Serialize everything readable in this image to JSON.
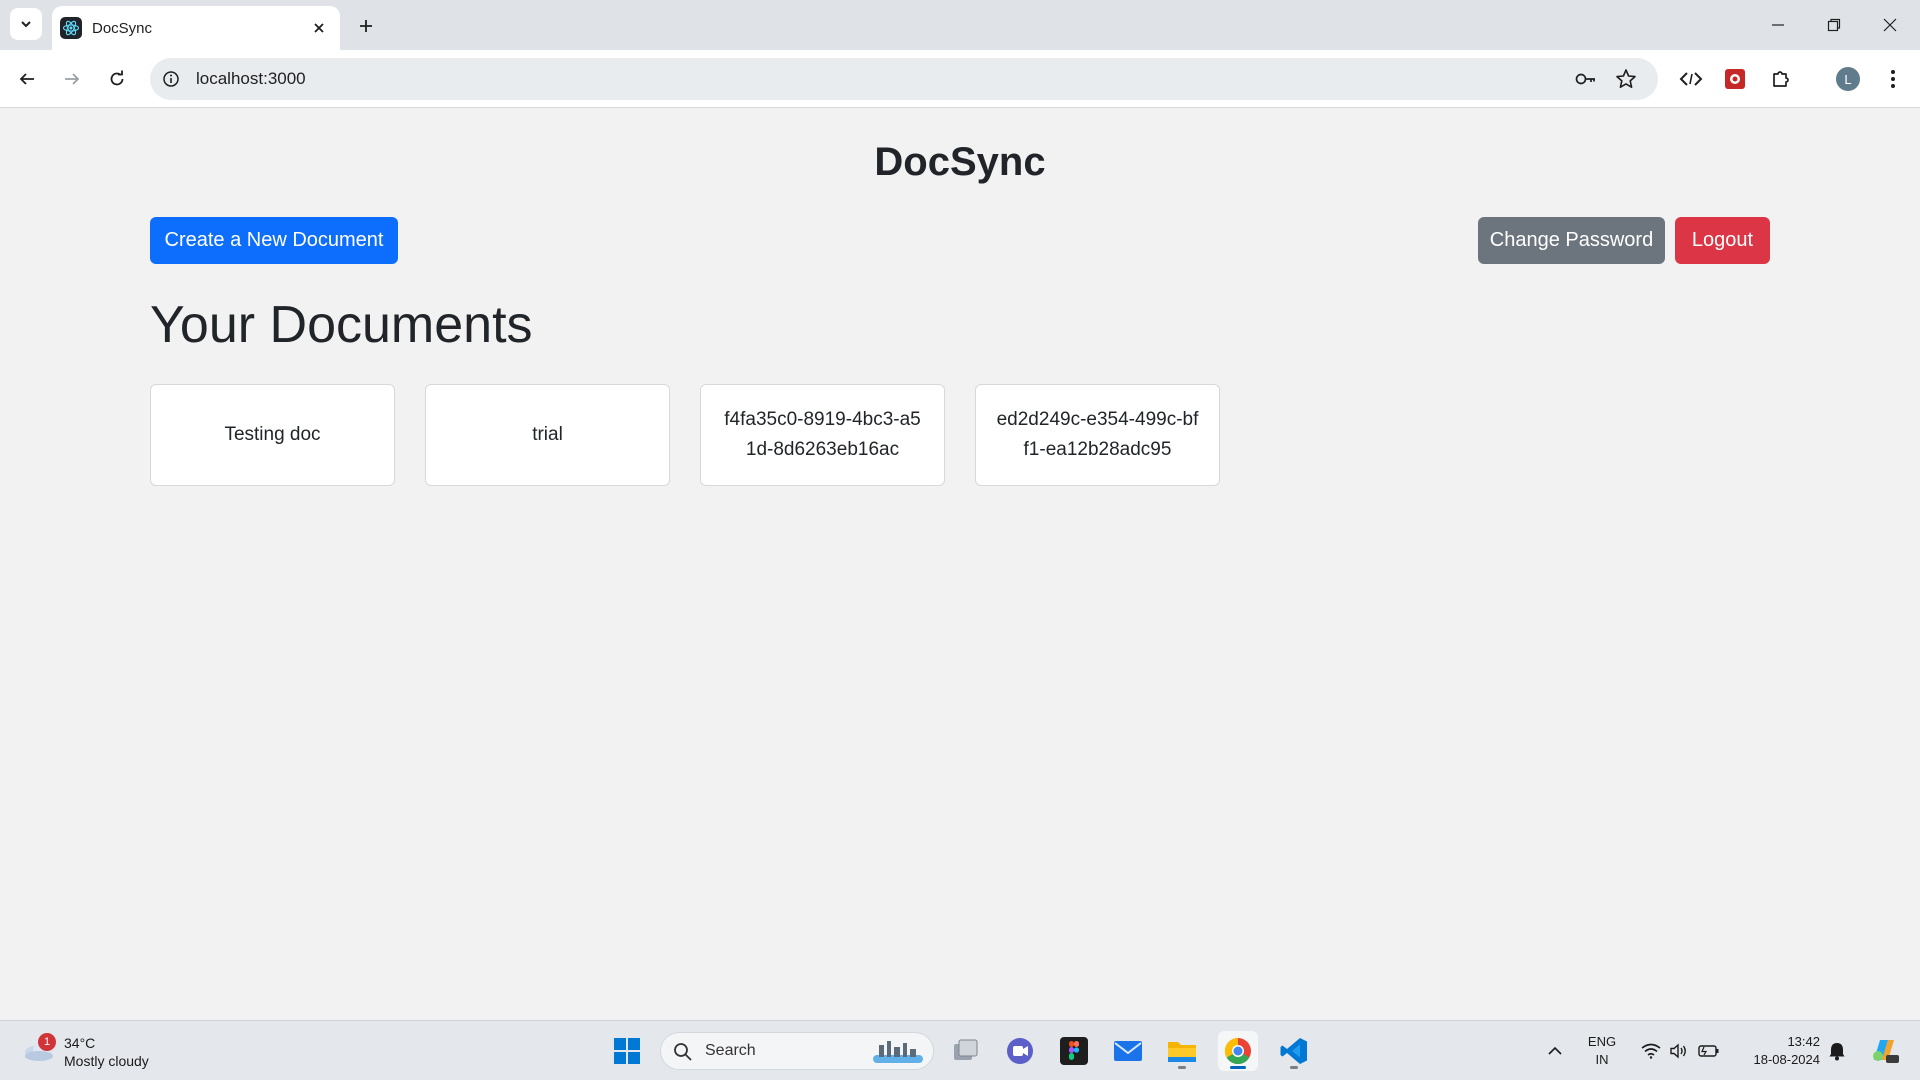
{
  "browser": {
    "tab_title": "DocSync",
    "url": "localhost:3000",
    "profile_initial": "L"
  },
  "app": {
    "title": "DocSync",
    "buttons": {
      "create": "Create a New Document",
      "change_password": "Change Password",
      "logout": "Logout"
    },
    "section_title": "Your Documents",
    "documents": [
      "Testing doc",
      "trial",
      "f4fa35c0-8919-4bc3-a51d-8d6263eb16ac",
      "ed2d249c-e354-499c-bff1-ea12b28adc95"
    ],
    "colors": {
      "primary": "#0d6efd",
      "secondary": "#6c757d",
      "danger": "#dc3545",
      "background": "#f2f2f2"
    }
  },
  "taskbar": {
    "weather": {
      "badge": "1",
      "temp": "34°C",
      "desc": "Mostly cloudy"
    },
    "search_label": "Search",
    "apps": [
      "start-icon",
      "search-icon",
      "task-view-icon",
      "teams-icon",
      "figma-icon",
      "mail-icon",
      "file-explorer-icon",
      "chrome-icon",
      "vscode-icon"
    ],
    "lang_primary": "ENG",
    "lang_secondary": "IN",
    "time": "13:42",
    "date": "18-08-2024"
  }
}
